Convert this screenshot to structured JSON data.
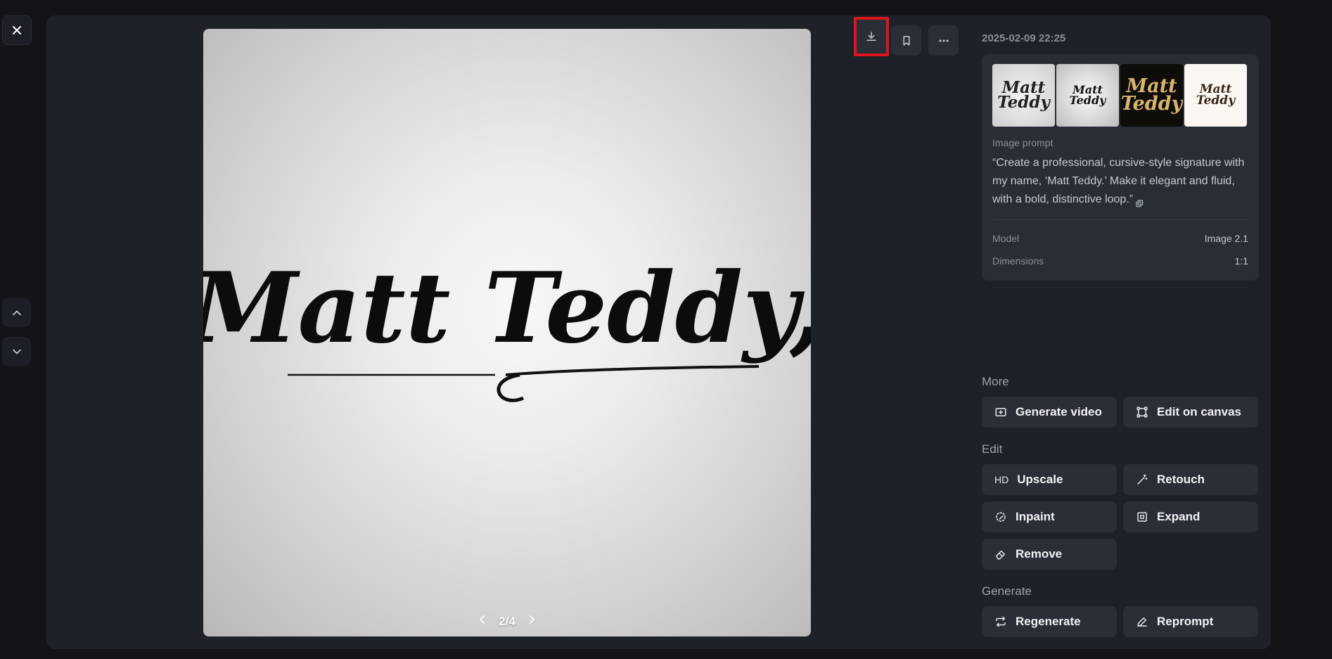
{
  "viewer": {
    "pager": "2/4",
    "signature_text": "Matt Teddy,"
  },
  "toolbar": {
    "download_icon": "download-icon",
    "bookmark_icon": "bookmark-icon",
    "more_icon": "more-horizontal-icon",
    "highlight_color": "#e0141e"
  },
  "details": {
    "timestamp": "2025-02-09 22:25",
    "thumbnails": [
      {
        "text": "Matt Teddy"
      },
      {
        "text": "Matt Teddy"
      },
      {
        "text": "Matt Teddy"
      },
      {
        "text": "Matt Teddy"
      }
    ],
    "prompt_label": "Image prompt",
    "prompt_text": "“Create a professional, cursive-style signature with my name, ‘Matt Teddy.’ Make it elegant and fluid, with a bold, distinctive loop.”",
    "model_label": "Model",
    "model_value": "Image 2.1",
    "dimensions_label": "Dimensions",
    "dimensions_value": "1:1"
  },
  "more": {
    "title": "More",
    "generate_video": "Generate video",
    "edit_on_canvas": "Edit on canvas"
  },
  "edit": {
    "title": "Edit",
    "upscale_prefix": "HD",
    "upscale": "Upscale",
    "retouch": "Retouch",
    "inpaint": "Inpaint",
    "expand": "Expand",
    "remove": "Remove"
  },
  "generate": {
    "title": "Generate",
    "regenerate": "Regenerate",
    "reprompt": "Reprompt"
  }
}
